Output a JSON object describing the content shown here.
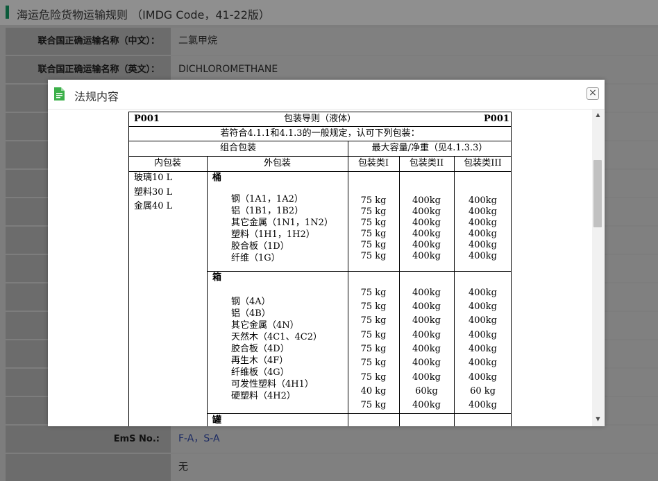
{
  "header": {
    "title": "海运危险货物运输规则 （IMDG Code，41-22版）"
  },
  "fields": {
    "cn_name": {
      "label": "联合国正确运输名称（中文）：",
      "value": "二氯甲烷"
    },
    "en_name": {
      "label": "联合国正确运输名称（英文）：",
      "value": "DICHLOROMETHANE"
    },
    "ems": {
      "label": "EmS No.:",
      "value": "F-A，S-A"
    },
    "partial": {
      "label": "",
      "value": "无"
    }
  },
  "modal": {
    "title": "法规内容",
    "close_icon": "close-icon",
    "doc_icon": "document-icon",
    "doc_icon_color": "#3cb04a"
  },
  "regulation": {
    "code_left": "P001",
    "code_right": "P001",
    "title": "包装导则（液体）",
    "provision": "若符合4.1.1和4.1.3的一般规定，认可下列包装：",
    "combination_header": "组合包装",
    "max_capacity_header": "最大容量/净重（见4.1.3.3）",
    "inner_header": "内包装",
    "outer_header": "外包装",
    "group_headers": [
      "包装类I",
      "包装类II",
      "包装类III"
    ],
    "inner_packagings": [
      "玻璃10 L",
      "塑料30 L",
      "金属40 L"
    ],
    "sections": [
      {
        "name": "桶",
        "items": [
          {
            "label": "钢（1A1，1A2）",
            "values": [
              "75 kg",
              "400kg",
              "400kg"
            ]
          },
          {
            "label": "铝（1B1，1B2）",
            "values": [
              "75 kg",
              "400kg",
              "400kg"
            ]
          },
          {
            "label": "其它金属（1N1，1N2）",
            "values": [
              "75 kg",
              "400kg",
              "400kg"
            ]
          },
          {
            "label": "塑料（1H1，1H2）",
            "values": [
              "75 kg",
              "400kg",
              "400kg"
            ]
          },
          {
            "label": "胶合板（1D）",
            "values": [
              "75 kg",
              "400kg",
              "400kg"
            ]
          },
          {
            "label": "纤维（1G）",
            "values": [
              "75 kg",
              "400kg",
              "400kg"
            ]
          }
        ]
      },
      {
        "name": "箱",
        "items": [
          {
            "label": "钢（4A）",
            "values": [
              "75 kg",
              "400kg",
              "400kg"
            ]
          },
          {
            "label": "铝（4B）",
            "values": [
              "75 kg",
              "400kg",
              "400kg"
            ]
          },
          {
            "label": "其它金属（4N）",
            "values": [
              "75 kg",
              "400kg",
              "400kg"
            ]
          },
          {
            "label": "天然木（4C1、4C2）",
            "values": [
              "75 kg",
              "400kg",
              "400kg"
            ]
          },
          {
            "label": "胶合板（4D）",
            "values": [
              "75 kg",
              "400kg",
              "400kg"
            ]
          },
          {
            "label": "再生木（4F）",
            "values": [
              "75 kg",
              "400kg",
              "400kg"
            ]
          },
          {
            "label": "纤维板（4G）",
            "values": [
              "75 kg",
              "400kg",
              "400kg"
            ]
          },
          {
            "label": "可发性塑料（4H1）",
            "values": [
              "40 kg",
              "60kg",
              "60 kg"
            ]
          },
          {
            "label": "硬塑料（4H2）",
            "values": [
              "75 kg",
              "400kg",
              "400kg"
            ]
          }
        ]
      },
      {
        "name": "罐",
        "items": []
      }
    ]
  }
}
